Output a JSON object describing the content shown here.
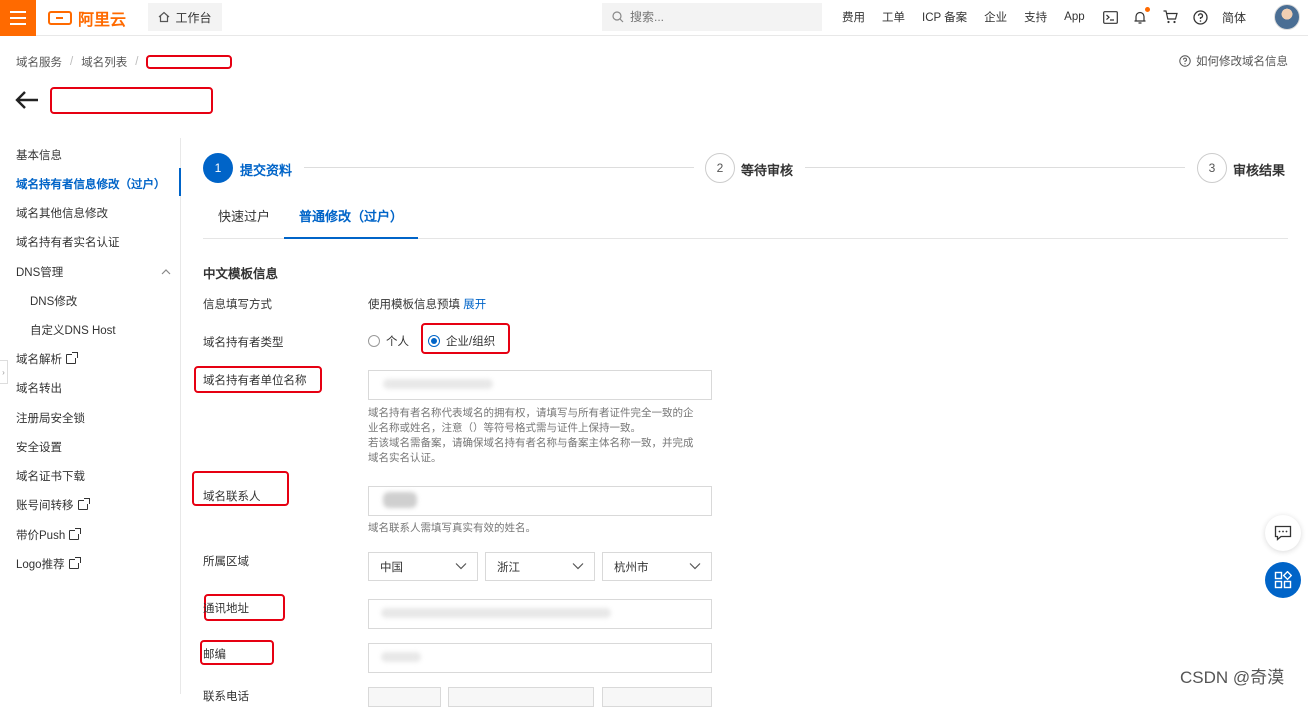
{
  "topbar": {
    "brand": "阿里云",
    "workbench": "工作台",
    "search_placeholder": "搜索...",
    "links": [
      "费用",
      "工单",
      "ICP 备案",
      "企业",
      "支持",
      "App"
    ],
    "lang": "简体",
    "icons": [
      "terminal-icon",
      "bell-icon",
      "cart-icon",
      "help-icon"
    ]
  },
  "breadcrumb": {
    "items": [
      "域名服务",
      "域名列表"
    ]
  },
  "help_link": "如何修改域名信息",
  "sidebar": {
    "items": [
      "基本信息",
      "域名持有者信息修改（过户）",
      "域名其他信息修改",
      "域名持有者实名认证",
      "DNS管理",
      "DNS修改",
      "自定义DNS Host",
      "域名解析",
      "域名转出",
      "注册局安全锁",
      "安全设置",
      "域名证书下载",
      "账号间转移",
      "带价Push",
      "Logo推荐"
    ]
  },
  "steps": [
    {
      "num": "1",
      "label": "提交资料"
    },
    {
      "num": "2",
      "label": "等待审核"
    },
    {
      "num": "3",
      "label": "审核结果"
    }
  ],
  "tabs": [
    "快速过户",
    "普通修改（过户）"
  ],
  "form": {
    "section_title": "中文模板信息",
    "fill_method_label": "信息填写方式",
    "fill_method_value": "使用模板信息预填",
    "fill_method_link": "展开",
    "holder_type_label": "域名持有者类型",
    "holder_type_options": [
      "个人",
      "企业/组织"
    ],
    "holder_name_label": "域名持有者单位名称",
    "holder_name_hint": [
      "域名持有者名称代表域名的拥有权，请填写与所有者证件完全一致的企",
      "业名称或姓名，注意（）等符号格式需与证件上保持一致。",
      "若该域名需备案，请确保域名持有者名称与备案主体名称一致，并完成",
      "域名实名认证。"
    ],
    "contact_label": "域名联系人",
    "contact_hint": "域名联系人需填写真实有效的姓名。",
    "region_label": "所属区域",
    "region_values": [
      "中国",
      "浙江",
      "杭州市"
    ],
    "address_label": "通讯地址",
    "zip_label": "邮编",
    "phone_label": "联系电话"
  },
  "watermark": "CSDN @奇漠",
  "colors": {
    "accent": "#0064c8",
    "brand": "#ff6a00",
    "highlight": "#e60012"
  }
}
